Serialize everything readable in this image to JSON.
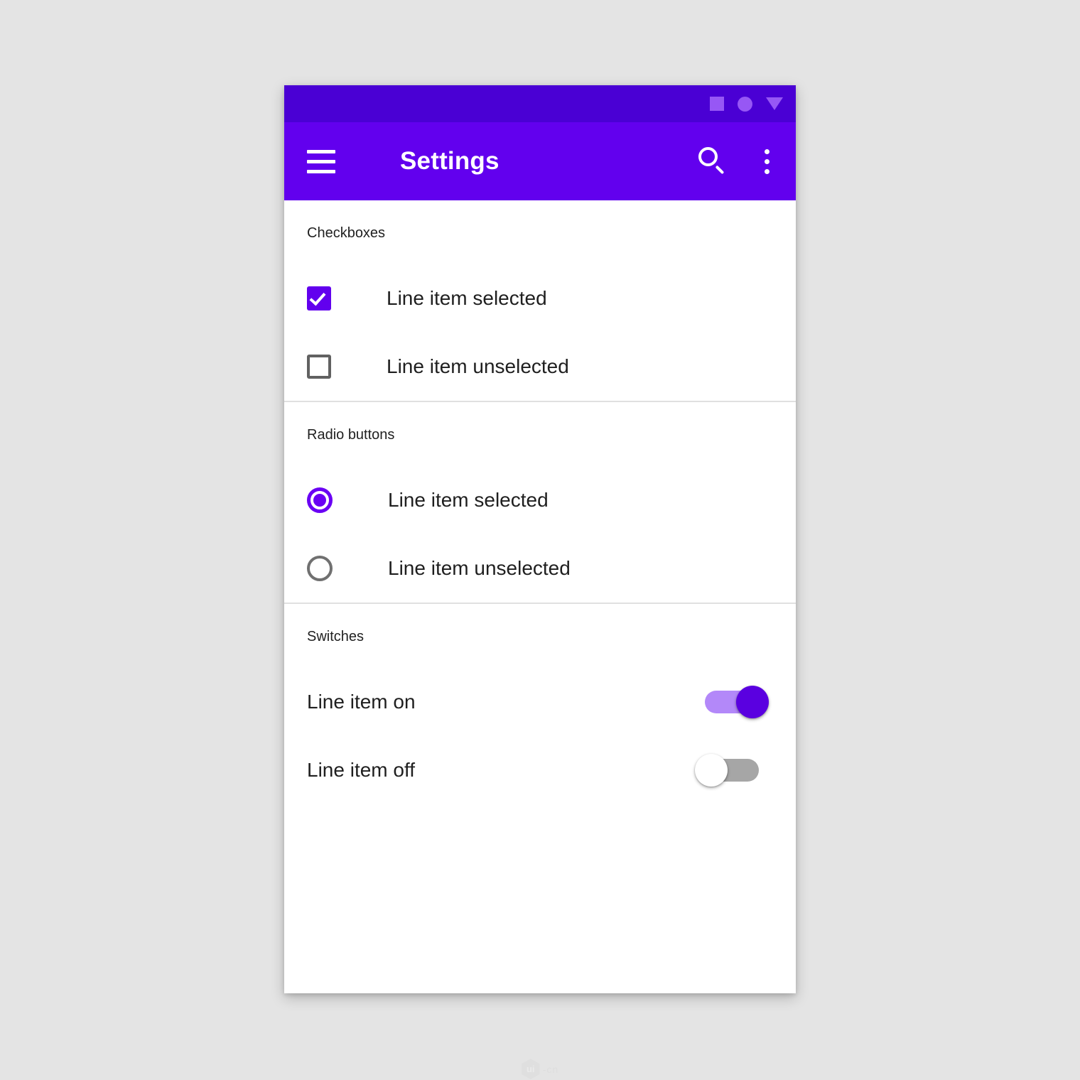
{
  "app": {
    "title": "Settings",
    "brand_color": "#6200EE",
    "status_bar_color": "#4A00D4",
    "status_bar_icon_color": "#9757F5",
    "accent_color": "#6200EE",
    "switch_on_track_color": "#B388F9",
    "switch_on_thumb_color": "#5A00E0",
    "switch_off_track_color": "#A6A6A6",
    "switch_off_thumb_color": "#FFFFFF",
    "unselected_outline_color": "#616161",
    "text_color": "#1F1F1F",
    "divider_color": "#E0E0E0",
    "page_background": "#E4E4E4"
  },
  "status_bar": {
    "icons": [
      {
        "name": "square-icon",
        "glyph": "square"
      },
      {
        "name": "circle-icon",
        "glyph": "circle"
      },
      {
        "name": "triangle-down-icon",
        "glyph": "triangle-down"
      }
    ]
  },
  "app_bar": {
    "menu_icon": "hamburger-menu-icon",
    "title": "Settings",
    "actions": [
      {
        "name": "search-icon",
        "label": "Search"
      },
      {
        "name": "overflow-menu-icon",
        "label": "More options"
      }
    ]
  },
  "sections": [
    {
      "id": "checkboxes",
      "header": "Checkboxes",
      "type": "checkbox",
      "items": [
        {
          "label": "Line item selected",
          "checked": true
        },
        {
          "label": "Line item unselected",
          "checked": false
        }
      ]
    },
    {
      "id": "radio-buttons",
      "header": "Radio buttons",
      "type": "radio",
      "items": [
        {
          "label": "Line item selected",
          "checked": true
        },
        {
          "label": "Line item unselected",
          "checked": false
        }
      ]
    },
    {
      "id": "switches",
      "header": "Switches",
      "type": "switch",
      "items": [
        {
          "label": "Line item on",
          "checked": true
        },
        {
          "label": "Line item off",
          "checked": false
        }
      ]
    }
  ],
  "watermark": {
    "mark": "ui",
    "text": "-cn"
  }
}
